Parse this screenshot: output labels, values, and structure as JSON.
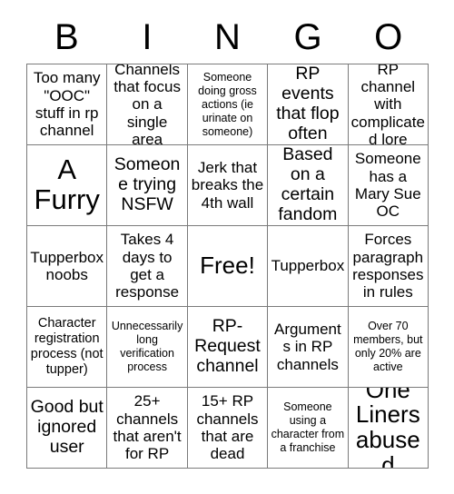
{
  "card": {
    "header_letters": [
      "B",
      "I",
      "N",
      "G",
      "O"
    ],
    "free_space_label": "Free!",
    "rows": [
      [
        {
          "text": "Too many \"OOC\" stuff in rp channel",
          "size": "m"
        },
        {
          "text": "Channels that focus on a single area",
          "size": "m"
        },
        {
          "text": "Someone doing gross actions (ie urinate on someone)",
          "size": "xs"
        },
        {
          "text": "RP events that flop often",
          "size": "l"
        },
        {
          "text": "RP channel with complicated lore",
          "size": "m"
        }
      ],
      [
        {
          "text": "A Furry",
          "size": "xxl"
        },
        {
          "text": "Someone trying NSFW",
          "size": "l"
        },
        {
          "text": "Jerk that breaks the 4th wall",
          "size": "m"
        },
        {
          "text": "Based on a certain fandom",
          "size": "l"
        },
        {
          "text": "Someone has a Mary Sue OC",
          "size": "m"
        }
      ],
      [
        {
          "text": "Tupperbox noobs",
          "size": "m"
        },
        {
          "text": "Takes 4 days to get a response",
          "size": "m"
        },
        {
          "text": "Free!",
          "size": "xl"
        },
        {
          "text": "Tupperbox",
          "size": "m"
        },
        {
          "text": "Forces paragraph responses in rules",
          "size": "m"
        }
      ],
      [
        {
          "text": "Character registration process (not tupper)",
          "size": "s"
        },
        {
          "text": "Unnecessarily long verification process",
          "size": "xs"
        },
        {
          "text": "RP-Request channel",
          "size": "l"
        },
        {
          "text": "Arguments in RP channels",
          "size": "m"
        },
        {
          "text": "Over 70 members, but only 20% are active",
          "size": "xs"
        }
      ],
      [
        {
          "text": "Good but ignored user",
          "size": "l"
        },
        {
          "text": "25+ channels that aren't for RP",
          "size": "m"
        },
        {
          "text": "15+ RP channels that are dead",
          "size": "m"
        },
        {
          "text": "Someone using a character from a franchise",
          "size": "xs"
        },
        {
          "text": "One Liners abused",
          "size": "xl"
        }
      ]
    ]
  }
}
